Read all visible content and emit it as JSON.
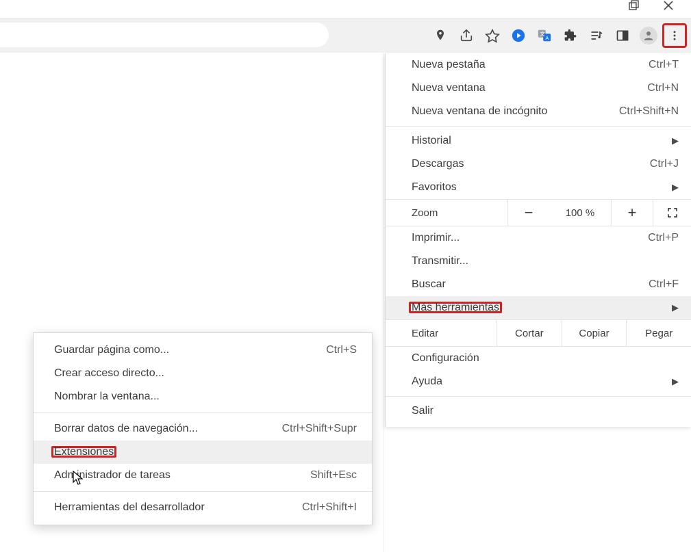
{
  "window": {
    "maximize_icon": "maximize",
    "close_icon": "close"
  },
  "toolbar": {
    "icons": {
      "location": "location-pin",
      "share": "share",
      "star": "bookmark-star",
      "ext_cast": "cast-play-blue",
      "ext_translate": "google-translate",
      "ext_puzzle": "extensions-puzzle",
      "ext_playlist": "playlist",
      "panel": "side-panel",
      "avatar": "user-avatar",
      "kebab": "kebab-menu"
    }
  },
  "menu": {
    "new_tab": {
      "label": "Nueva pestaña",
      "accel": "Ctrl+T"
    },
    "new_window": {
      "label": "Nueva ventana",
      "accel": "Ctrl+N"
    },
    "incognito": {
      "label": "Nueva ventana de incógnito",
      "accel": "Ctrl+Shift+N"
    },
    "history": {
      "label": "Historial"
    },
    "downloads": {
      "label": "Descargas",
      "accel": "Ctrl+J"
    },
    "bookmarks": {
      "label": "Favoritos"
    },
    "zoom": {
      "label": "Zoom",
      "pct": "100 %",
      "minus": "−",
      "plus": "+"
    },
    "print": {
      "label": "Imprimir...",
      "accel": "Ctrl+P"
    },
    "cast": {
      "label": "Transmitir..."
    },
    "find": {
      "label": "Buscar",
      "accel": "Ctrl+F"
    },
    "more_tools": {
      "label": "Más herramientas"
    },
    "edit": {
      "label": "Editar",
      "cut": "Cortar",
      "copy": "Copiar",
      "paste": "Pegar"
    },
    "settings": {
      "label": "Configuración"
    },
    "help": {
      "label": "Ayuda"
    },
    "exit": {
      "label": "Salir"
    }
  },
  "submenu": {
    "save_as": {
      "label": "Guardar página como...",
      "accel": "Ctrl+S"
    },
    "shortcut": {
      "label": "Crear acceso directo..."
    },
    "name_win": {
      "label": "Nombrar la ventana..."
    },
    "clear_data": {
      "label": "Borrar datos de navegación...",
      "accel": "Ctrl+Shift+Supr"
    },
    "extensions": {
      "label": "Extensiones"
    },
    "task_mgr": {
      "label": "Administrador de tareas",
      "accel": "Shift+Esc"
    },
    "dev_tools": {
      "label": "Herramientas del desarrollador",
      "accel": "Ctrl+Shift+I"
    }
  },
  "colors": {
    "highlight_red": "#d02424",
    "hover_grey": "#efefef"
  }
}
